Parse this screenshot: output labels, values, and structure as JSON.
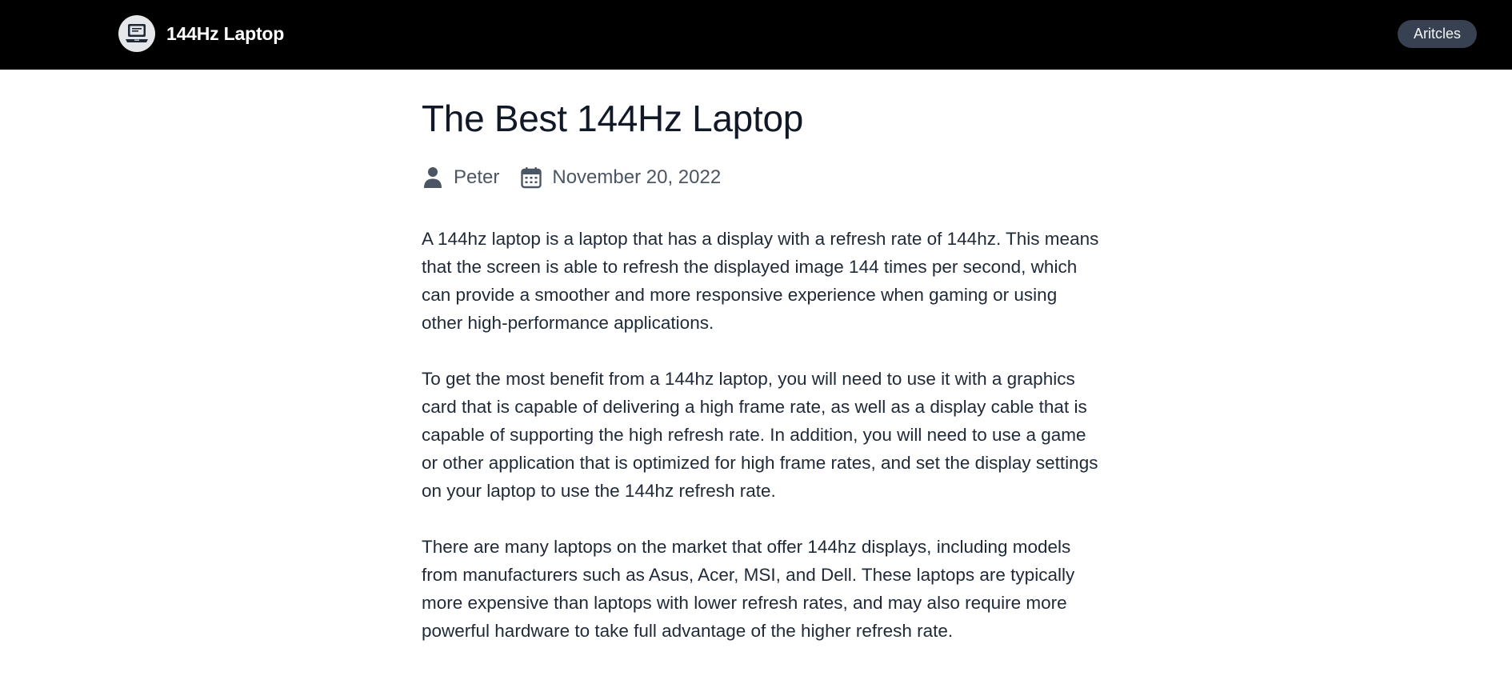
{
  "header": {
    "brand_name": "144Hz Laptop",
    "logo_icon": "laptop-icon",
    "nav_label": "Aritcles",
    "background_color": "#000000",
    "pill_color": "#374151"
  },
  "article": {
    "title": "The Best 144Hz Laptop",
    "author_icon": "user-icon",
    "author": "Peter",
    "date_icon": "calendar-icon",
    "date": "November 20, 2022",
    "paragraphs": [
      "A 144hz laptop is a laptop that has a display with a refresh rate of 144hz. This means that the screen is able to refresh the displayed image 144 times per second, which can provide a smoother and more responsive experience when gaming or using other high-performance applications.",
      "To get the most benefit from a 144hz laptop, you will need to use it with a graphics card that is capable of delivering a high frame rate, as well as a display cable that is capable of supporting the high refresh rate. In addition, you will need to use a game or other application that is optimized for high frame rates, and set the display settings on your laptop to use the 144hz refresh rate.",
      "There are many laptops on the market that offer 144hz displays, including models from manufacturers such as Asus, Acer, MSI, and Dell. These laptops are typically more expensive than laptops with lower refresh rates, and may also require more powerful hardware to take full advantage of the higher refresh rate."
    ]
  }
}
